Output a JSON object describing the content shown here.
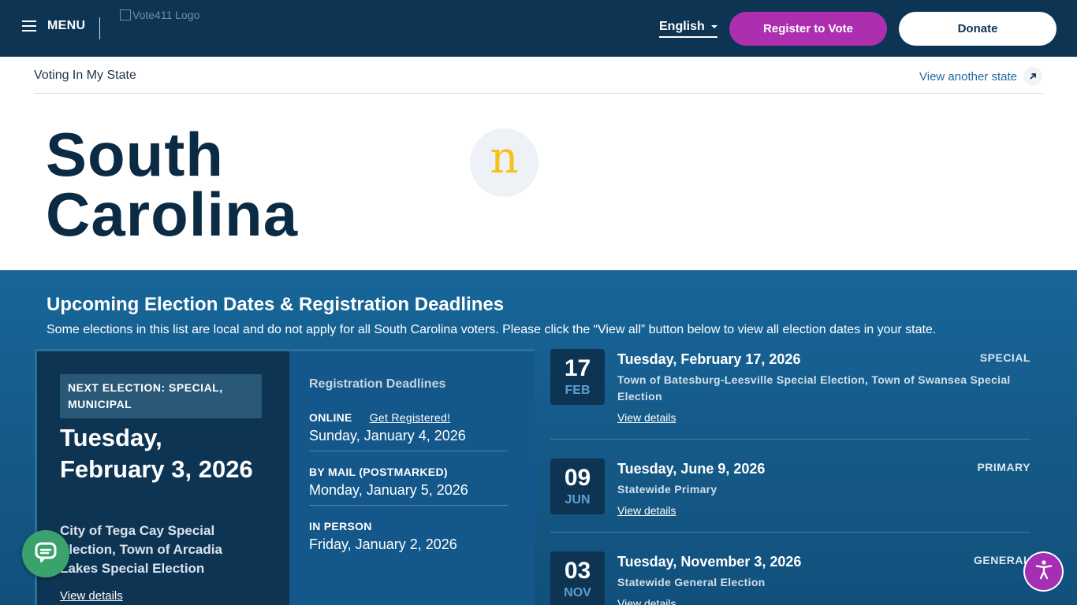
{
  "header": {
    "menu_label": "MENU",
    "logo_alt": "Vote411 Logo",
    "language": "English",
    "register_label": "Register to Vote",
    "donate_label": "Donate"
  },
  "subheader": {
    "crumb": "Voting In My State",
    "view_another": "View another state"
  },
  "hero": {
    "state_line1": "South",
    "state_line2": "Carolina",
    "badge_letter": "n"
  },
  "elections": {
    "title": "Upcoming Election Dates & Registration Deadlines",
    "description": "Some elections in this list are local and do not apply for all South Carolina voters. Please click the “View all” button below to view all election dates in your state.",
    "next": {
      "label": "NEXT ELECTION: SPECIAL, MUNICIPAL",
      "date": "Tuesday, February 3, 2026",
      "description": "City of Tega Cay Special Election, Town of Arcadia Lakes Special Election",
      "link": "View details"
    },
    "registration": {
      "title": "Registration Deadlines",
      "online_label": "ONLINE",
      "online_link": "Get Registered!",
      "online_date": "Sunday, January 4, 2026",
      "mail_label": "BY MAIL (POSTMARKED)",
      "mail_date": "Monday, January 5, 2026",
      "person_label": "IN PERSON",
      "person_date": "Friday, January 2, 2026"
    },
    "list": [
      {
        "day": "17",
        "month": "FEB",
        "title": "Tuesday, February 17, 2026",
        "type": "SPECIAL",
        "description": "Town of Batesburg-Leesville Special Election, Town of Swansea Special Election",
        "link": "View details"
      },
      {
        "day": "09",
        "month": "JUN",
        "title": "Tuesday, June 9, 2026",
        "type": "PRIMARY",
        "description": "Statewide Primary",
        "link": "View details"
      },
      {
        "day": "03",
        "month": "NOV",
        "title": "Tuesday, November 3, 2026",
        "type": "GENERAL",
        "description": "Statewide General Election",
        "link": "View details"
      }
    ]
  },
  "colors": {
    "header_bg": "#0e3454",
    "register_btn": "#ad2fb0",
    "section_bg": "#17669a",
    "date_box": "#0e3454",
    "chat_btn": "#3aa36d",
    "accessibility_btn": "#a42fb3",
    "badge_letter": "#f3c21b"
  },
  "icons": {
    "menu": "hamburger-icon",
    "language": "chevron-down-icon",
    "view_another": "arrow-up-right-icon",
    "chat": "chat-icon",
    "accessibility": "accessibility-icon"
  }
}
